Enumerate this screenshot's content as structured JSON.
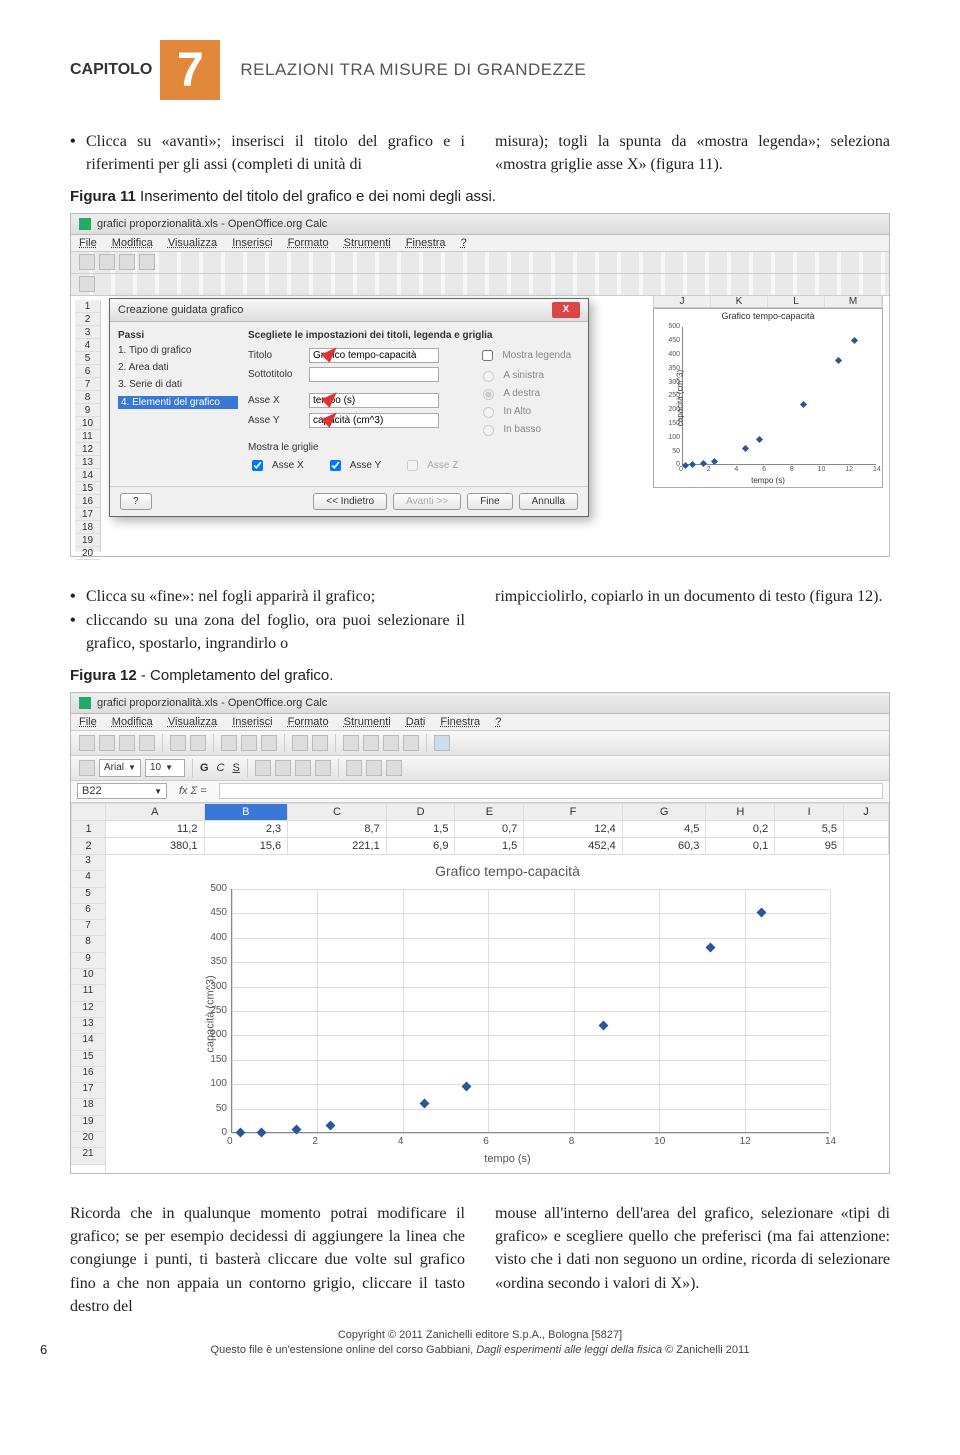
{
  "header": {
    "capitolo": "CAPITOLO",
    "number": "7",
    "title": "RELAZIONI TRA MISURE DI GRANDEZZE"
  },
  "para1_left": "Clicca su «avanti»; inserisci il titolo del grafico e i riferimenti per gli assi (completi di unità di",
  "para1_right": "misura); togli la spunta da «mostra legenda»; seleziona «mostra griglie asse X» (figura 11).",
  "fig11_caption_bold": "Figura 11",
  "fig11_caption_rest": " Inserimento del titolo del grafico e dei nomi degli assi.",
  "shot1": {
    "window_title": "grafici proporzionalità.xls - OpenOffice.org Calc",
    "menus": [
      "File",
      "Modifica",
      "Visualizza",
      "Inserisci",
      "Formato",
      "Strumenti",
      "Finestra",
      "?"
    ],
    "dialog_title": "Creazione guidata grafico",
    "steps_title": "Passi",
    "steps": [
      "1. Tipo di grafico",
      "2. Area dati",
      "3. Serie di dati",
      "4. Elementi del grafico"
    ],
    "section_head": "Scegliete le impostazioni dei titoli, legenda e griglia",
    "lbl_titolo": "Titolo",
    "val_titolo": "Grafico tempo-capacità",
    "lbl_sottotitolo": "Sottotitolo",
    "lbl_assex": "Asse X",
    "val_assex": "tempo (s)",
    "lbl_assey": "Asse Y",
    "val_assey": "capacità (cm^3)",
    "lbl_legenda": "Mostra legenda",
    "radio_sinistra": "A sinistra",
    "radio_destra": "A destra",
    "radio_alto": "In Alto",
    "radio_basso": "In basso",
    "lbl_griglie": "Mostra le griglie",
    "chk_assex": "Asse X",
    "chk_assey": "Asse Y",
    "chk_assez": "Asse Z",
    "btn_help": "?",
    "btn_back": "<< Indietro",
    "btn_next": "Avanti >>",
    "btn_fine": "Fine",
    "btn_annulla": "Annulla",
    "preview_title": "Grafico tempo-capacità",
    "preview_ylabel": "capacità (cm^3)",
    "preview_xlabel": "tempo (s)",
    "col_letters": [
      "J",
      "K",
      "L",
      "M"
    ]
  },
  "para2_left_b1": "Clicca su «fine»: nel fogli apparirà il grafico;",
  "para2_left_b2": "cliccando su una zona del foglio, ora puoi selezionare il grafico, spostarlo, ingrandirlo o",
  "para2_right": "rimpicciolirlo, copiarlo in un documento di testo (figura 12).",
  "fig12_caption_bold": "Figura 12",
  "fig12_caption_rest": " - Completamento del grafico.",
  "shot2": {
    "window_title": "grafici proporzionalità.xls - OpenOffice.org Calc",
    "menus": [
      "File",
      "Modifica",
      "Visualizza",
      "Inserisci",
      "Formato",
      "Strumenti",
      "Dati",
      "Finestra",
      "?"
    ],
    "font_name": "Arial",
    "font_size": "10",
    "cell_ref": "B22",
    "fx": "fx  Σ  =",
    "columns": [
      "",
      "A",
      "B",
      "C",
      "D",
      "E",
      "F",
      "G",
      "H",
      "I",
      "J"
    ],
    "row1": [
      "1",
      "11,2",
      "2,3",
      "8,7",
      "1,5",
      "0,7",
      "12,4",
      "4,5",
      "0,2",
      "5,5",
      ""
    ],
    "row2": [
      "2",
      "380,1",
      "15,6",
      "221,1",
      "6,9",
      "1,5",
      "452,4",
      "60,3",
      "0,1",
      "95",
      ""
    ],
    "chart_title": "Grafico tempo-capacità",
    "ylabel": "capacità (cm^3)",
    "xlabel": "tempo (s)"
  },
  "chart_data": {
    "type": "scatter",
    "title": "Grafico tempo-capacità",
    "xlabel": "tempo (s)",
    "ylabel": "capacità (cm^3)",
    "xlim": [
      0,
      14
    ],
    "ylim": [
      0,
      500
    ],
    "xticks": [
      0,
      2,
      4,
      6,
      8,
      10,
      12,
      14
    ],
    "yticks": [
      0,
      50,
      100,
      150,
      200,
      250,
      300,
      350,
      400,
      450,
      500
    ],
    "series": [
      {
        "name": "capacità",
        "x": [
          0.2,
          0.7,
          1.5,
          2.3,
          4.5,
          5.5,
          8.7,
          11.2,
          12.4
        ],
        "y": [
          0.1,
          1.5,
          6.9,
          15.6,
          60.3,
          95,
          221.1,
          380.1,
          452.4
        ]
      }
    ]
  },
  "preview_chart_data": {
    "type": "scatter",
    "xlim": [
      0,
      14
    ],
    "ylim": [
      0,
      500
    ],
    "yticks": [
      0,
      50,
      100,
      150,
      200,
      250,
      300,
      350,
      400,
      450,
      500
    ],
    "xticks": [
      0,
      2,
      4,
      6,
      8,
      10,
      12,
      14
    ]
  },
  "para3_left": "Ricorda che in qualunque momento potrai modificare il grafico; se per esempio decidessi di aggiungere la linea che congiunge i punti, ti basterà cliccare due volte sul grafico fino a che non appaia un contorno grigio, cliccare il tasto destro del",
  "para3_right": "mouse all'interno dell'area del grafico, selezionare «tipi di grafico» e scegliere quello che preferisci (ma fai attenzione: visto che i dati non seguono un ordine, ricorda di selezionare «ordina secondo i valori di X»).",
  "page_number": "6",
  "footer_line1": "Copyright © 2011 Zanichelli editore S.p.A., Bologna [5827]",
  "footer_line2_a": "Questo file è un'estensione online del corso Gabbiani, ",
  "footer_line2_i": "Dagli esperimenti alle leggi della fisica",
  "footer_line2_b": " © Zanichelli 2011"
}
